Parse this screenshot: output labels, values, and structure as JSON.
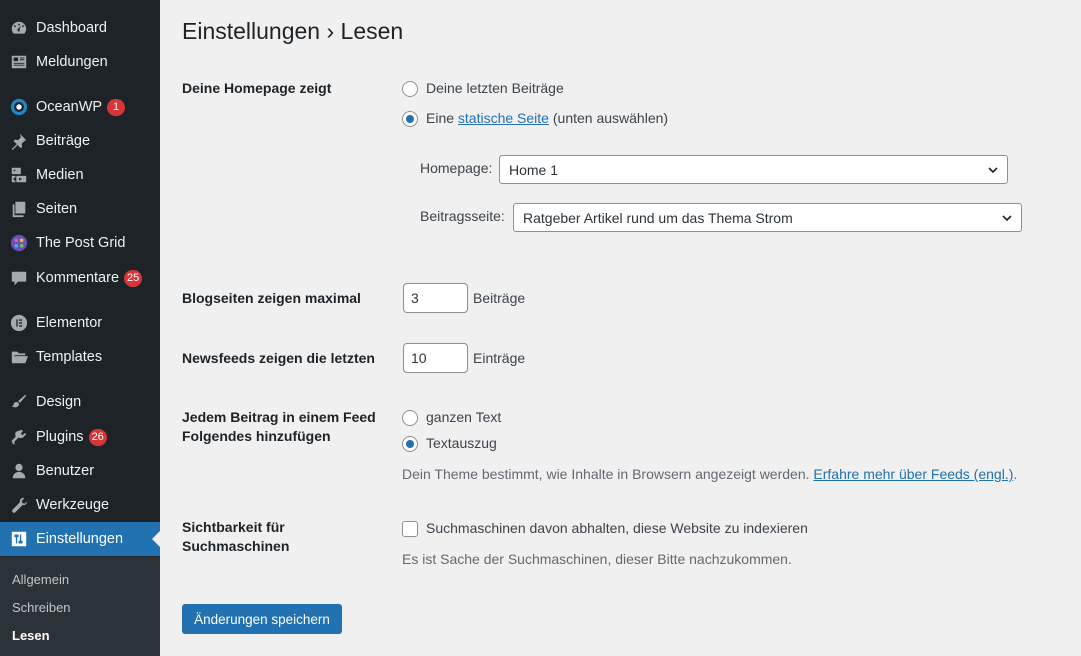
{
  "sidebar": {
    "items": [
      {
        "label": "Dashboard",
        "icon": "dashboard-icon"
      },
      {
        "label": "Meldungen",
        "icon": "news-icon"
      },
      {
        "label": "OceanWP",
        "icon": "oceanwp-icon",
        "badge": "1"
      },
      {
        "label": "Beiträge",
        "icon": "pin-icon"
      },
      {
        "label": "Medien",
        "icon": "media-icon"
      },
      {
        "label": "Seiten",
        "icon": "pages-icon"
      },
      {
        "label": "The Post Grid",
        "icon": "post-grid-icon"
      },
      {
        "label": "Kommentare",
        "icon": "comment-icon",
        "badge": "25"
      },
      {
        "label": "Elementor",
        "icon": "elementor-icon"
      },
      {
        "label": "Templates",
        "icon": "folder-icon"
      },
      {
        "label": "Design",
        "icon": "brush-icon"
      },
      {
        "label": "Plugins",
        "icon": "plugin-icon",
        "badge": "26"
      },
      {
        "label": "Benutzer",
        "icon": "user-icon"
      },
      {
        "label": "Werkzeuge",
        "icon": "wrench-icon"
      },
      {
        "label": "Einstellungen",
        "icon": "settings-icon",
        "active": true
      }
    ],
    "submenu": [
      "Allgemein",
      "Schreiben",
      "Lesen"
    ],
    "submenu_current": "Lesen"
  },
  "page": {
    "title": "Einstellungen › Lesen",
    "homepage_section": {
      "label": "Deine Homepage zeigt",
      "option_latest": "Deine letzten Beiträge",
      "option_static_prefix": "Eine",
      "option_static_link": "statische Seite",
      "option_static_suffix": "(unten auswählen)",
      "selected": "static",
      "homepage_label": "Homepage:",
      "homepage_value": "Home 1",
      "postspage_label": "Beitragsseite:",
      "postspage_value": "Ratgeber Artikel rund um das Thema Strom"
    },
    "blog_pages": {
      "label": "Blogseiten zeigen maximal",
      "value": "3",
      "unit": "Beiträge"
    },
    "newsfeeds": {
      "label": "Newsfeeds zeigen die letzten",
      "value": "10",
      "unit": "Einträge"
    },
    "feed_content": {
      "label_line1": "Jedem Beitrag in einem Feed",
      "label_line2": "Folgendes hinzufügen",
      "option_full": "ganzen Text",
      "option_excerpt": "Textauszug",
      "selected": "excerpt",
      "desc_prefix": "Dein Theme bestimmt, wie Inhalte in Browsern angezeigt werden.",
      "desc_link": "Erfahre mehr über Feeds (engl.)",
      "desc_suffix": "."
    },
    "search_visibility": {
      "label_line1": "Sichtbarkeit für",
      "label_line2": "Suchmaschinen",
      "checkbox_label": "Suchmaschinen davon abhalten, diese Website zu indexieren",
      "checked": false,
      "desc": "Es ist Sache der Suchmaschinen, dieser Bitte nachzukommen."
    },
    "save_button": "Änderungen speichern"
  },
  "colors": {
    "sidebar_bg": "#1d2327",
    "accent": "#2271b1",
    "badge": "#d63638",
    "page_bg": "#f0f0f1"
  }
}
